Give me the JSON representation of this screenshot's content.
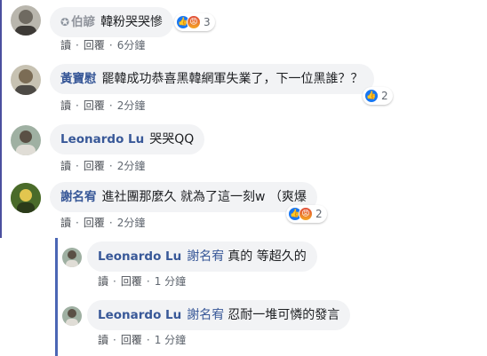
{
  "comments": [
    {
      "name": "伯諺",
      "text": "韓粉哭哭慘",
      "reactions": {
        "icons": [
          "like",
          "angry"
        ],
        "count": "3"
      },
      "actions": {
        "read": "讀",
        "reply": "回覆",
        "time": "6分鐘"
      }
    },
    {
      "name": "黃寶慰",
      "text": "罷韓成功恭喜黑韓網軍失業了，下一位黑誰？？",
      "reactions": {
        "icons": [
          "like"
        ],
        "count": "2"
      },
      "actions": {
        "read": "讀",
        "reply": "回覆",
        "time": "2分鐘"
      }
    },
    {
      "name": "Leonardo Lu",
      "text": "哭哭QQ",
      "actions": {
        "read": "讀",
        "reply": "回覆",
        "time": "2分鐘"
      }
    },
    {
      "name": "謝名宥",
      "text": "進社團那麼久 就為了這一刻w （爽爆",
      "reactions": {
        "icons": [
          "like",
          "angry"
        ],
        "count": "2"
      },
      "actions": {
        "read": "讀",
        "reply": "回覆",
        "time": "2分鐘"
      }
    }
  ],
  "replies": [
    {
      "name": "Leonardo Lu",
      "tag": "謝名宥",
      "text": "真的 等超久的",
      "actions": {
        "read": "讀",
        "reply": "回覆",
        "time": "1 分鐘"
      }
    },
    {
      "name": "Leonardo Lu",
      "tag": "謝名宥",
      "text": "忍耐一堆可憐的發言",
      "actions": {
        "read": "讀",
        "reply": "回覆",
        "time": "1 分鐘"
      }
    }
  ],
  "colors": {
    "name": "#385898",
    "bubble": "#f2f3f5",
    "like": "#1877f2",
    "rail": "#4b66b5"
  },
  "icons": {
    "star": "star-icon",
    "like": "like-icon",
    "angry": "angry-icon"
  }
}
